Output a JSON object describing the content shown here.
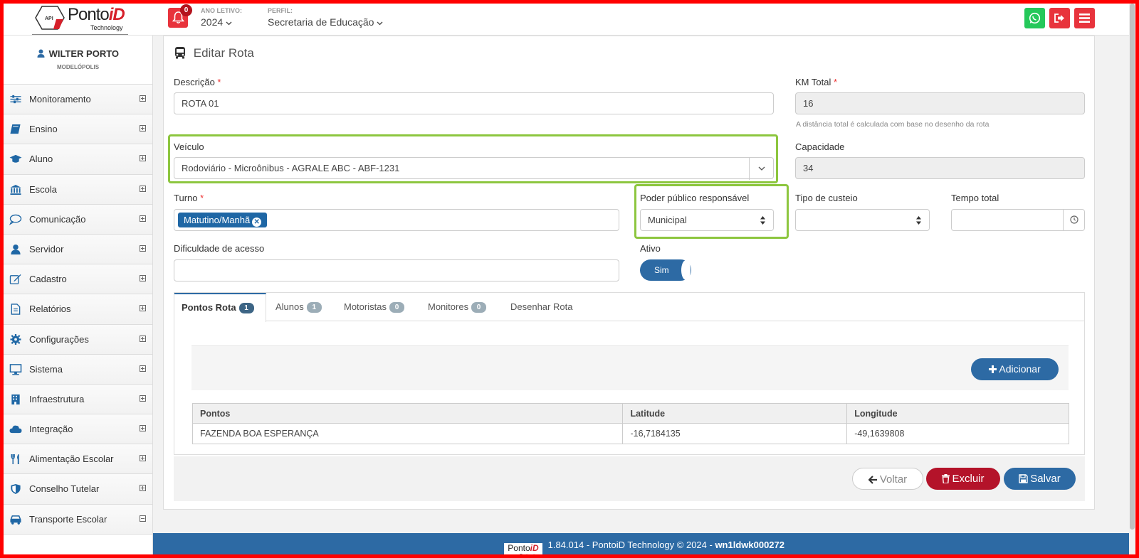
{
  "header": {
    "logo_text": "Ponto",
    "logo_text_accent": "iD",
    "logo_sub": "Technology",
    "logo_badge": "API",
    "notifications_count": "0",
    "ano_label": "ANO LETIVO:",
    "ano_value": "2024",
    "perfil_label": "PERFIL:",
    "perfil_value": "Secretaria de Educação"
  },
  "user": {
    "name": "WILTER PORTO",
    "city": "MODELÓPOLIS"
  },
  "sidebar": {
    "items": [
      {
        "label": "Monitoramento",
        "icon": "sliders-icon",
        "expanded": false
      },
      {
        "label": "Ensino",
        "icon": "book-icon",
        "expanded": false
      },
      {
        "label": "Aluno",
        "icon": "graduation-cap-icon",
        "expanded": false
      },
      {
        "label": "Escola",
        "icon": "bank-icon",
        "expanded": false
      },
      {
        "label": "Comunicação",
        "icon": "chat-bubble-icon",
        "expanded": false
      },
      {
        "label": "Servidor",
        "icon": "user-icon",
        "expanded": false
      },
      {
        "label": "Cadastro",
        "icon": "edit-icon",
        "expanded": false
      },
      {
        "label": "Relatórios",
        "icon": "document-icon",
        "expanded": false
      },
      {
        "label": "Configurações",
        "icon": "gear-icon",
        "expanded": false
      },
      {
        "label": "Sistema",
        "icon": "desktop-icon",
        "expanded": false
      },
      {
        "label": "Infraestrutura",
        "icon": "building-icon",
        "expanded": false
      },
      {
        "label": "Integração",
        "icon": "cloud-icon",
        "expanded": false
      },
      {
        "label": "Alimentação Escolar",
        "icon": "cutlery-icon",
        "expanded": false
      },
      {
        "label": "Conselho Tutelar",
        "icon": "shield-icon",
        "expanded": false
      },
      {
        "label": "Transporte Escolar",
        "icon": "car-icon",
        "expanded": true
      }
    ]
  },
  "form": {
    "title": "Editar Rota",
    "descricao_label": "Descrição",
    "descricao_value": "ROTA 01",
    "km_label": "KM Total",
    "km_value": "16",
    "km_hint": "A distância total é calculada com base no desenho da rota",
    "veiculo_label": "Veículo",
    "veiculo_value": "Rodoviário - Microônibus - AGRALE ABC - ABF-1231",
    "capacidade_label": "Capacidade",
    "capacidade_value": "34",
    "turno_label": "Turno",
    "turno_tag": "Matutino/Manhã",
    "poder_label": "Poder público responsável",
    "poder_value": "Municipal",
    "custeio_label": "Tipo de custeio",
    "custeio_value": "",
    "tempo_label": "Tempo total",
    "tempo_value": "",
    "dificuldade_label": "Dificuldade de acesso",
    "dificuldade_value": "",
    "ativo_label": "Ativo",
    "ativo_value": "Sim",
    "required_mark": "*"
  },
  "tabs": [
    {
      "label": "Pontos Rota",
      "count": "1"
    },
    {
      "label": "Alunos",
      "count": "1"
    },
    {
      "label": "Motoristas",
      "count": "0"
    },
    {
      "label": "Monitores",
      "count": "0"
    },
    {
      "label": "Desenhar Rota",
      "count": ""
    }
  ],
  "points": {
    "add_label": "Adicionar",
    "columns": [
      "Pontos",
      "Latitude",
      "Longitude"
    ],
    "rows": [
      [
        "FAZENDA BOA ESPERANÇA",
        "-16,7184135",
        "-49,1639808"
      ]
    ]
  },
  "actions": {
    "voltar": "Voltar",
    "excluir": "Excluir",
    "salvar": "Salvar"
  },
  "footer": {
    "logo_text": "Ponto",
    "logo_accent": "iD",
    "logo_sub": "Technology",
    "version_text": "1.84.014 - PontoiD Technology © 2024 - ",
    "host": "wn1ldwk000272"
  },
  "colors": {
    "primary": "#2d6aa4",
    "danger": "#b4132a",
    "whatsapp": "#25c85a",
    "logout": "#e8333c",
    "highlight": "#8dc63f"
  }
}
